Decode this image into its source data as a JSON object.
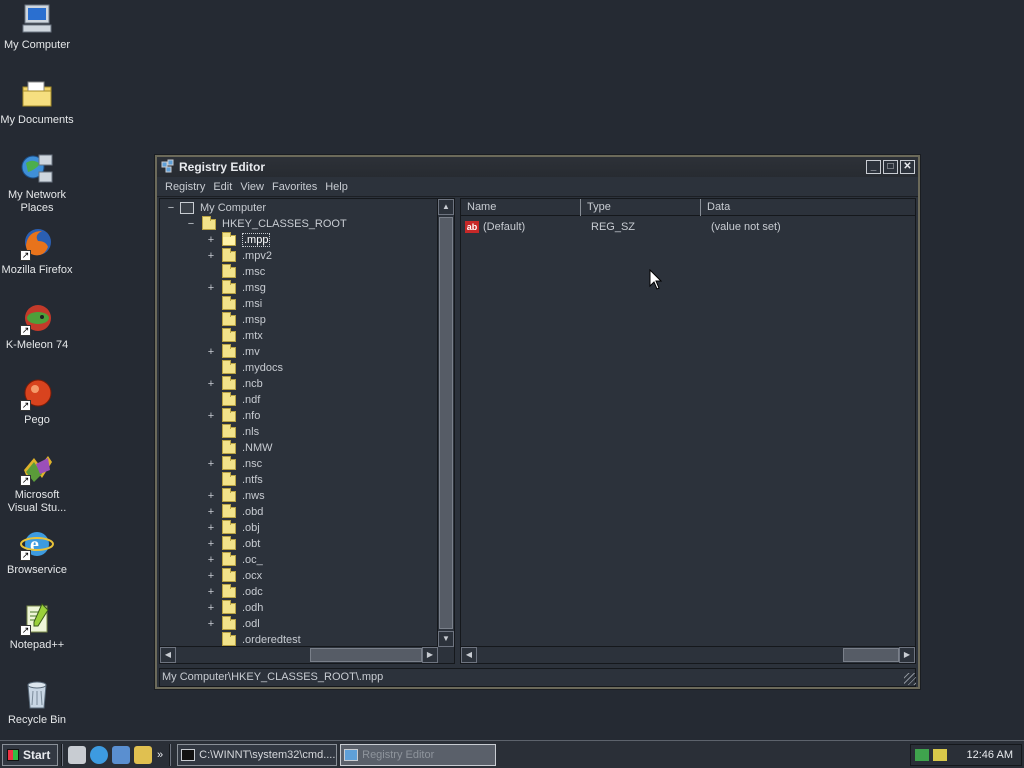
{
  "desktop": {
    "icons": [
      {
        "label_1": "My Computer",
        "label_2": ""
      },
      {
        "label_1": "My Documents",
        "label_2": ""
      },
      {
        "label_1": "My Network",
        "label_2": "Places"
      },
      {
        "label_1": "Mozilla Firefox",
        "label_2": ""
      },
      {
        "label_1": "K-Meleon 74",
        "label_2": ""
      },
      {
        "label_1": "Pego",
        "label_2": ""
      },
      {
        "label_1": "Microsoft",
        "label_2": "Visual Stu..."
      },
      {
        "label_1": "Browservice",
        "label_2": ""
      },
      {
        "label_1": "Notepad++",
        "label_2": ""
      },
      {
        "label_1": "Recycle Bin",
        "label_2": ""
      }
    ]
  },
  "window": {
    "title": "Registry Editor",
    "controls": {
      "minimize": "_",
      "maximize": "□",
      "close": "✕"
    },
    "menu": [
      "Registry",
      "Edit",
      "View",
      "Favorites",
      "Help"
    ],
    "tree": {
      "root_label": "My Computer",
      "root_expander": "−",
      "hive_label": "HKEY_CLASSES_ROOT",
      "hive_expander": "−",
      "items": [
        {
          "label": ".mpp",
          "expander": "+",
          "selected": true
        },
        {
          "label": ".mpv2",
          "expander": "+"
        },
        {
          "label": ".msc",
          "expander": ""
        },
        {
          "label": ".msg",
          "expander": "+"
        },
        {
          "label": ".msi",
          "expander": ""
        },
        {
          "label": ".msp",
          "expander": ""
        },
        {
          "label": ".mtx",
          "expander": ""
        },
        {
          "label": ".mv",
          "expander": "+"
        },
        {
          "label": ".mydocs",
          "expander": ""
        },
        {
          "label": ".ncb",
          "expander": "+"
        },
        {
          "label": ".ndf",
          "expander": ""
        },
        {
          "label": ".nfo",
          "expander": "+"
        },
        {
          "label": ".nls",
          "expander": ""
        },
        {
          "label": ".NMW",
          "expander": ""
        },
        {
          "label": ".nsc",
          "expander": "+"
        },
        {
          "label": ".ntfs",
          "expander": ""
        },
        {
          "label": ".nws",
          "expander": "+"
        },
        {
          "label": ".obd",
          "expander": "+"
        },
        {
          "label": ".obj",
          "expander": "+"
        },
        {
          "label": ".obt",
          "expander": "+"
        },
        {
          "label": ".oc_",
          "expander": "+"
        },
        {
          "label": ".ocx",
          "expander": "+"
        },
        {
          "label": ".odc",
          "expander": "+"
        },
        {
          "label": ".odh",
          "expander": "+"
        },
        {
          "label": ".odl",
          "expander": "+"
        },
        {
          "label": ".orderedtest",
          "expander": ""
        }
      ]
    },
    "list": {
      "columns": [
        "Name",
        "Type",
        "Data"
      ],
      "rows": [
        {
          "icon": "string-value-icon",
          "icon_text": "ab",
          "name": "(Default)",
          "type": "REG_SZ",
          "data": "(value not set)"
        }
      ]
    },
    "status": "My Computer\\HKEY_CLASSES_ROOT\\.mpp"
  },
  "taskbar": {
    "start_label": "Start",
    "quick_launch_chevron": "»",
    "tasks": [
      {
        "label": "C:\\WINNT\\system32\\cmd....",
        "active": false
      },
      {
        "label": "Registry Editor",
        "active": true
      }
    ],
    "clock": "12:46 AM"
  },
  "colors": {
    "desktop": "#252a33",
    "folder": "#f2e38a",
    "window_border": "#6c6a5a"
  }
}
